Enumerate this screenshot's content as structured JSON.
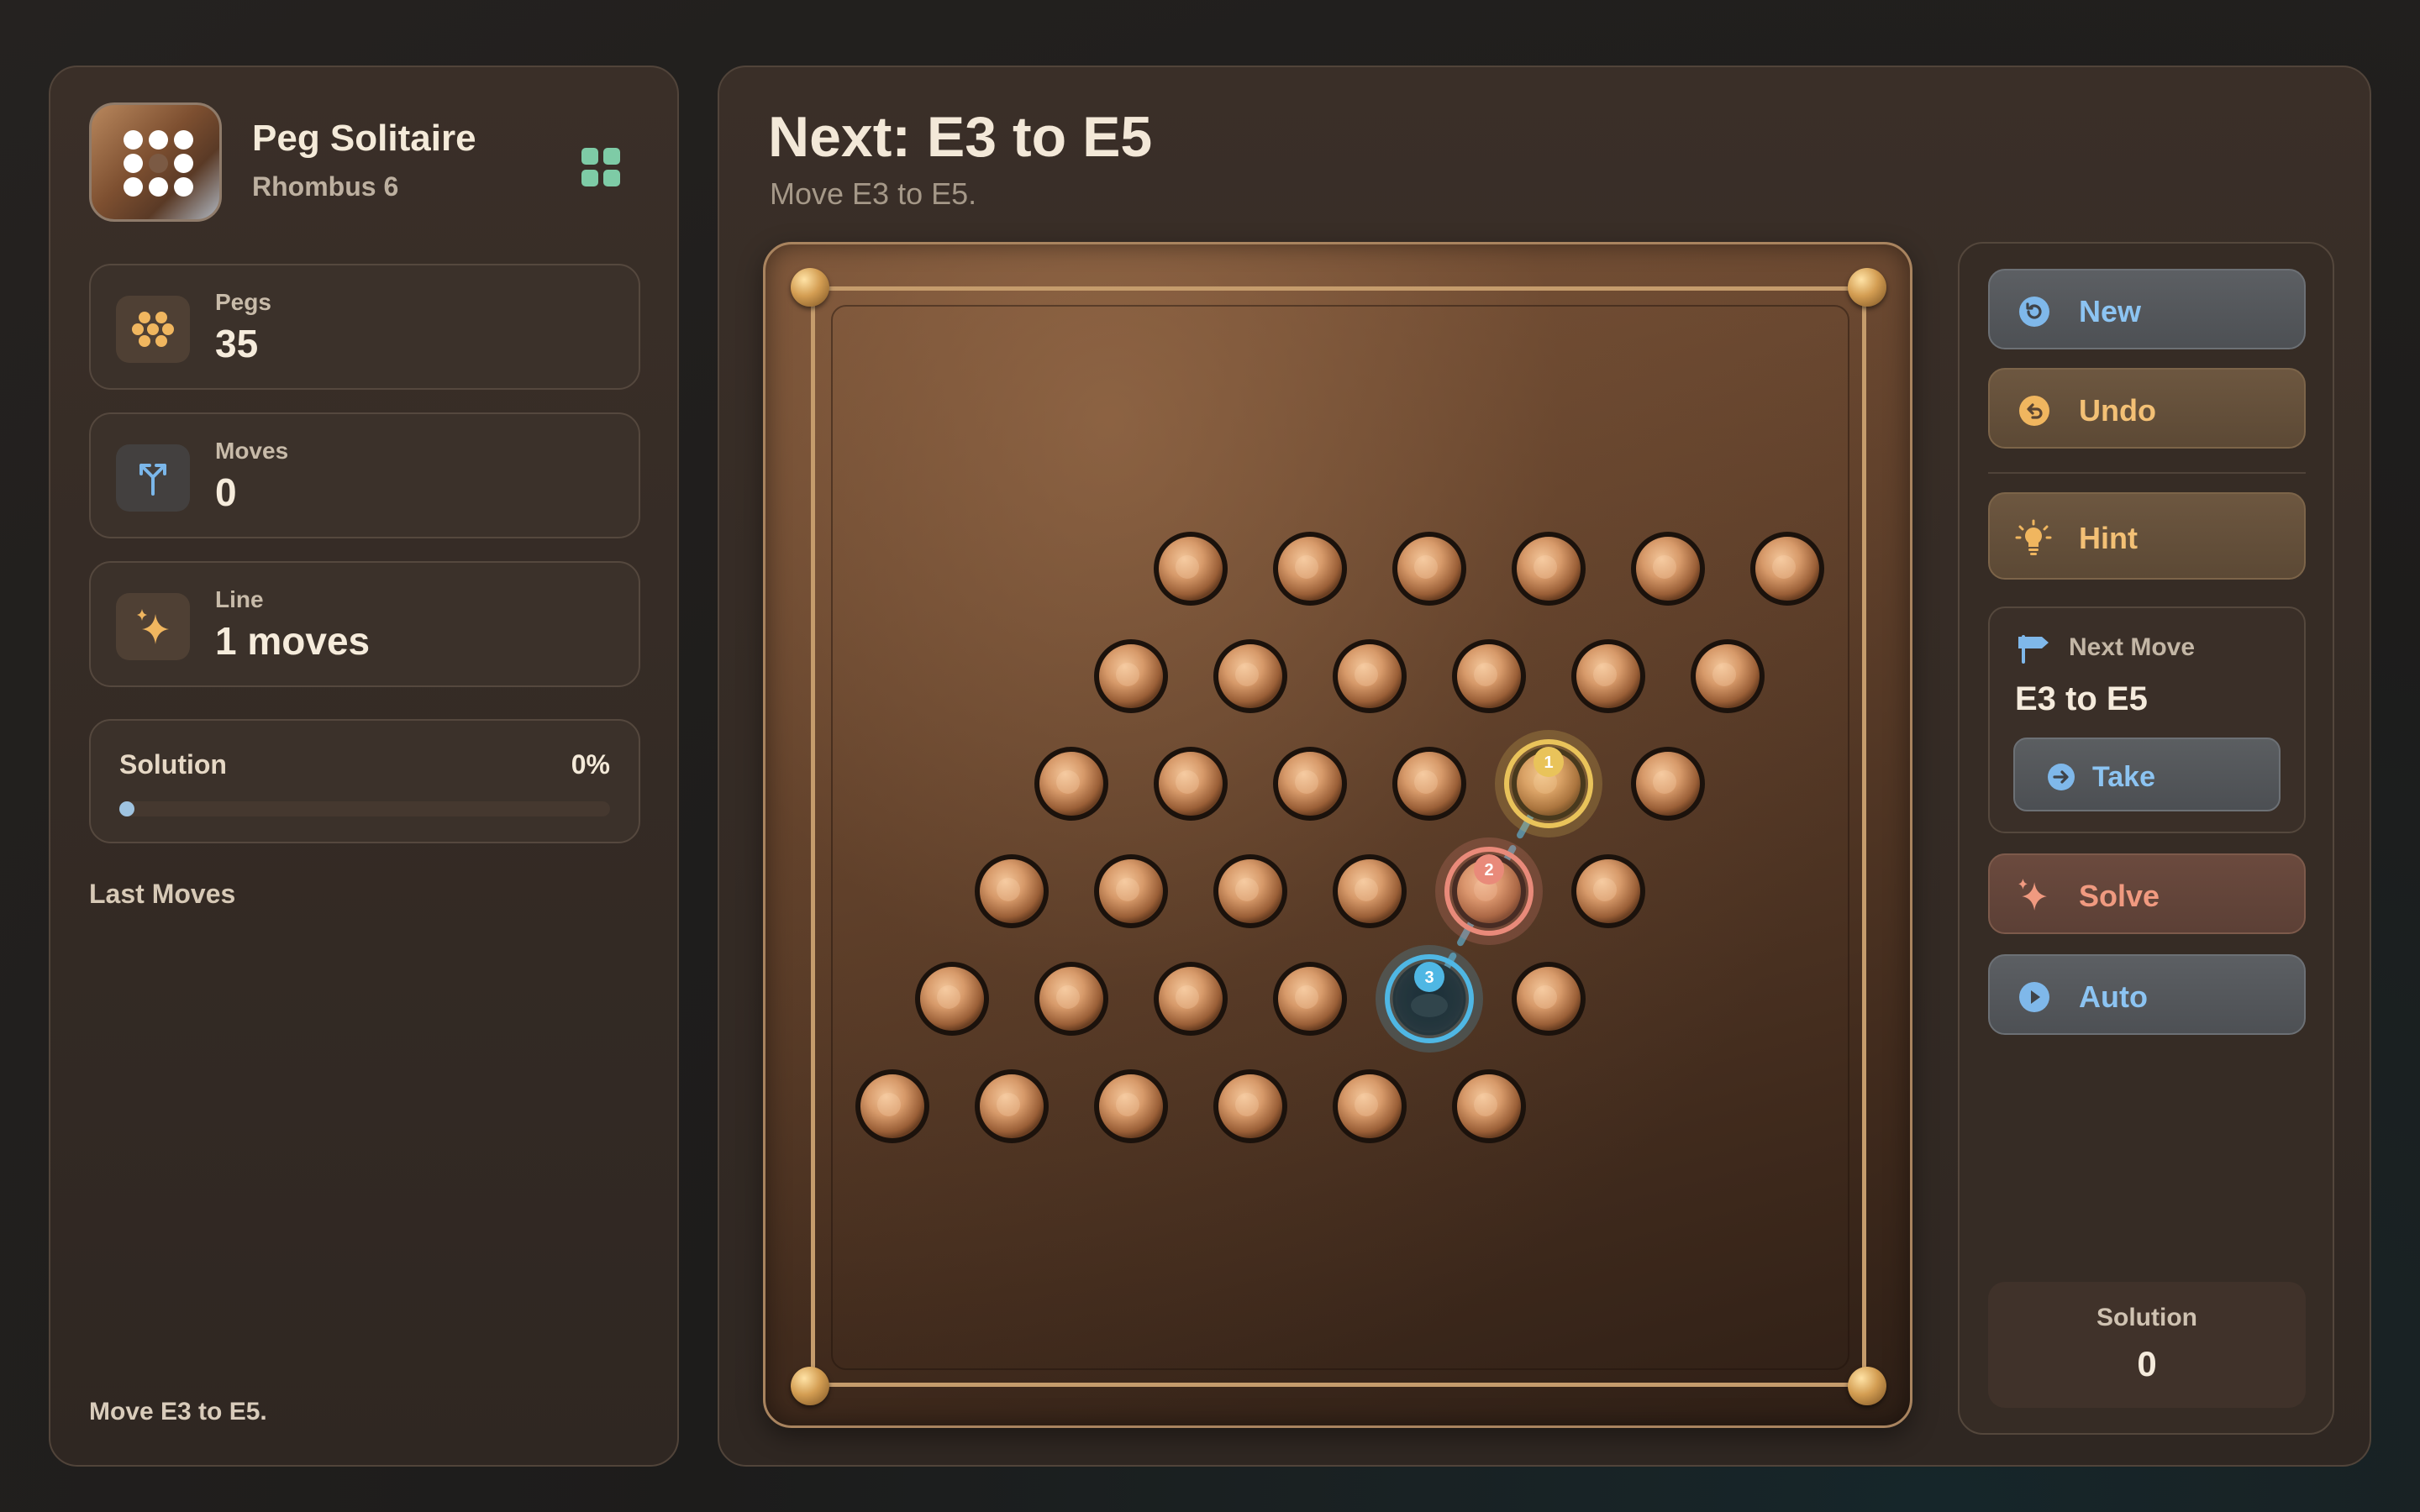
{
  "app": {
    "title": "Peg Solitaire",
    "subtitle": "Rhombus 6"
  },
  "stats": [
    {
      "label": "Pegs",
      "value": "35",
      "icon": "pegs-cluster-icon"
    },
    {
      "label": "Moves",
      "value": "0",
      "icon": "branch-icon"
    },
    {
      "label": "Line",
      "value": "1 moves",
      "icon": "sparkle-icon"
    }
  ],
  "solution_progress": {
    "label": "Solution",
    "percent_text": "0%",
    "fraction": 0.0
  },
  "last_moves": {
    "heading": "Last Moves",
    "items": []
  },
  "status_footer": "Move E3 to E5.",
  "main": {
    "title": "Next: E3 to E5",
    "subtitle": "Move E3 to E5."
  },
  "board": {
    "type": "rhombus",
    "size": 6,
    "rows": [
      [
        1,
        1,
        1,
        1,
        1,
        1
      ],
      [
        1,
        1,
        1,
        1,
        1,
        1
      ],
      [
        1,
        1,
        1,
        1,
        1,
        1
      ],
      [
        1,
        1,
        1,
        1,
        1,
        1
      ],
      [
        1,
        1,
        1,
        1,
        1,
        1
      ],
      [
        1,
        1,
        1,
        1,
        1,
        1
      ]
    ],
    "empty": [
      [
        4,
        4
      ]
    ],
    "move_markers": [
      {
        "step": "1",
        "row": 2,
        "col": 4,
        "color": "#e9c35a"
      },
      {
        "step": "2",
        "row": 3,
        "col": 4,
        "color": "#e98a7a"
      },
      {
        "step": "3",
        "row": 4,
        "col": 4,
        "color": "#4fb7e4"
      }
    ]
  },
  "controls": {
    "new_label": "New",
    "undo_label": "Undo",
    "hint_label": "Hint",
    "next_move_label": "Next Move",
    "next_move_value": "E3 to E5",
    "take_label": "Take",
    "solve_label": "Solve",
    "auto_label": "Auto",
    "solution_label": "Solution",
    "solution_value": "0"
  },
  "colors": {
    "accent_blue": "#8cc4f2",
    "accent_amber": "#f3c075",
    "accent_salmon": "#f09a80",
    "grid_icon": "#7ecba6"
  }
}
